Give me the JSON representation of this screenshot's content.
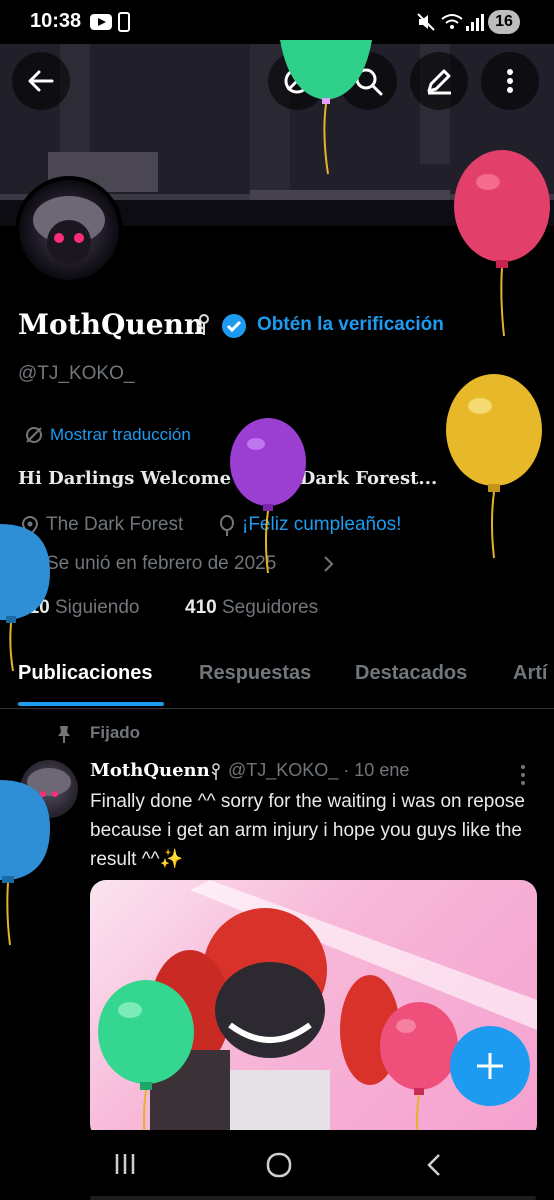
{
  "status": {
    "time": "10:38",
    "battery": "16"
  },
  "profile": {
    "name": "MothQuenn",
    "verify_label": "Obtén la verificación",
    "handle": "@TJ_KOKO_",
    "translate_label": "Mostrar traducción",
    "bio": "Hi Darlings Welcome to my Dark Forest...",
    "location": "The Dark Forest",
    "birthday": "¡Feliz cumpleaños!",
    "joined": "Se unió en febrero de 2025",
    "following_count": "210",
    "following_label": "Siguiendo",
    "followers_count": "410",
    "followers_label": "Seguidores"
  },
  "tabs": [
    "Publicaciones",
    "Respuestas",
    "Destacados",
    "Artí"
  ],
  "tweet": {
    "pinned_label": "Fijado",
    "name": "MothQuenn",
    "handle_date": "@TJ_KOKO_ · 10 ene",
    "text": "Finally done ^^ sorry for the waiting i was on repose because i get an arm injury i hope you guys like the result ^^✨"
  },
  "icons": {
    "back": "back-arrow-icon",
    "translate": "translate-icon",
    "search": "search-icon",
    "edit": "edit-icon",
    "more": "more-vertical-icon",
    "compose": "plus-icon"
  },
  "colors": {
    "accent": "#1d9bf0",
    "muted": "#71767b",
    "background": "#000000"
  }
}
